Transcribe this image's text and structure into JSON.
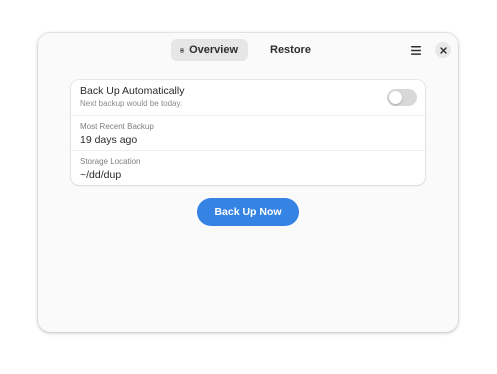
{
  "header": {
    "tabs": [
      {
        "label": "Overview",
        "icon": "backup-disk-icon",
        "active": true
      },
      {
        "label": "Restore",
        "icon": "clock-icon",
        "active": false
      }
    ],
    "menu_icon": "hamburger-menu-icon",
    "close_icon": "close-icon"
  },
  "backup_card": {
    "auto": {
      "title": "Back Up Automatically",
      "subtitle": "Next backup would be today.",
      "enabled": false
    },
    "recent": {
      "label": "Most Recent Backup",
      "value": "19 days ago"
    },
    "storage": {
      "label": "Storage Location",
      "value": "~/dd/dup"
    }
  },
  "primary_button": {
    "label": "Back Up Now"
  },
  "colors": {
    "accent": "#3584e4",
    "window_bg": "#fafafa",
    "card_bg": "#ffffff",
    "toggle_off": "#d8d8d8"
  }
}
